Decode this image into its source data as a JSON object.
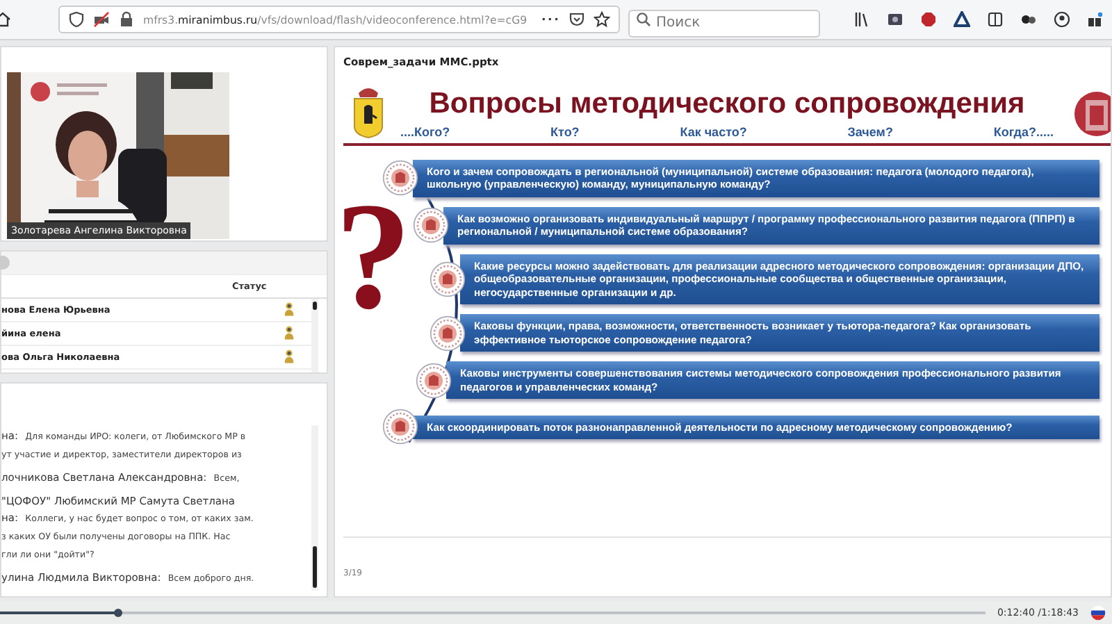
{
  "browser": {
    "url": {
      "prefix": "mfrs3.",
      "domain": "miranimbus.ru",
      "path": "/vfs/download/flash/videoconference.html?e=cG9"
    },
    "more": "•••",
    "search": {
      "placeholder": "Поиск"
    }
  },
  "video": {
    "caption": "Золотарева Ангелина Викторовна"
  },
  "participants": {
    "status_header": "Статус",
    "rows": [
      {
        "name": "нова Елена Юрьевна"
      },
      {
        "name": "йина елена"
      },
      {
        "name": "ова Ольга Николаевна"
      }
    ]
  },
  "chat": {
    "messages": [
      {
        "author_lines": [
          "на:"
        ],
        "lines": [
          "Для команды ИРО: колеги, от Любимского МР в",
          "ут участие и  директор, заместители директоров из"
        ]
      },
      {
        "author_lines": [
          "лочникова Светлана  Александровна:"
        ],
        "lines": [
          "Всем,"
        ]
      },
      {
        "author_lines": [
          "\"ЦОФОУ\" Любимский МР Самута Светлана",
          "на:"
        ],
        "lines": [
          "Коллеги, у нас будет вопрос о том, от каких зам.",
          "з каких ОУ были получены договоры на ППК. Нас",
          "гли ли они \"дойти\"?"
        ]
      },
      {
        "author_lines": [
          "улина Людмила  Викторовна:"
        ],
        "lines": [
          "Всем доброго дня."
        ]
      }
    ]
  },
  "presentation": {
    "file_name": "Соврем_задачи ММС.pptx",
    "page": "3/19",
    "slide": {
      "title": "Вопросы методического сопровождения",
      "questions": [
        "....Кого?",
        "Кто?",
        "Как часто?",
        "Зачем?",
        "Когда?....."
      ],
      "question_mark": "?",
      "items": [
        "Кого и зачем сопровождать в региональной (муниципальной) системе образования: педагога (молодого педагога), школьную (управленческую) команду, муниципальную команду?",
        "Как возможно организовать индивидуальный маршрут / программу профессионального развития педагога (ППРП) в  региональной / муниципальной системе образования?",
        "Какие ресурсы можно задействовать для реализации адресного методического сопровождения: организации ДПО, общеобразовательные организации, профессиональные сообщества и общественные организации, негосударственные организации и др.",
        "Каковы функции, права, возможности, ответственность возникает у тьютора-педагога? Как организовать эффективное тьюторское сопровождение педагога?",
        "Каковы инструменты совершенствования системы методического сопровождения профессионального развития педагогов и управленческих команд?",
        "Как скоординировать поток разнонаправленной деятельности по адресному методическому сопровождению?"
      ]
    }
  },
  "player": {
    "level": 0.12,
    "time": "0:12:40 /1:18:43"
  }
}
